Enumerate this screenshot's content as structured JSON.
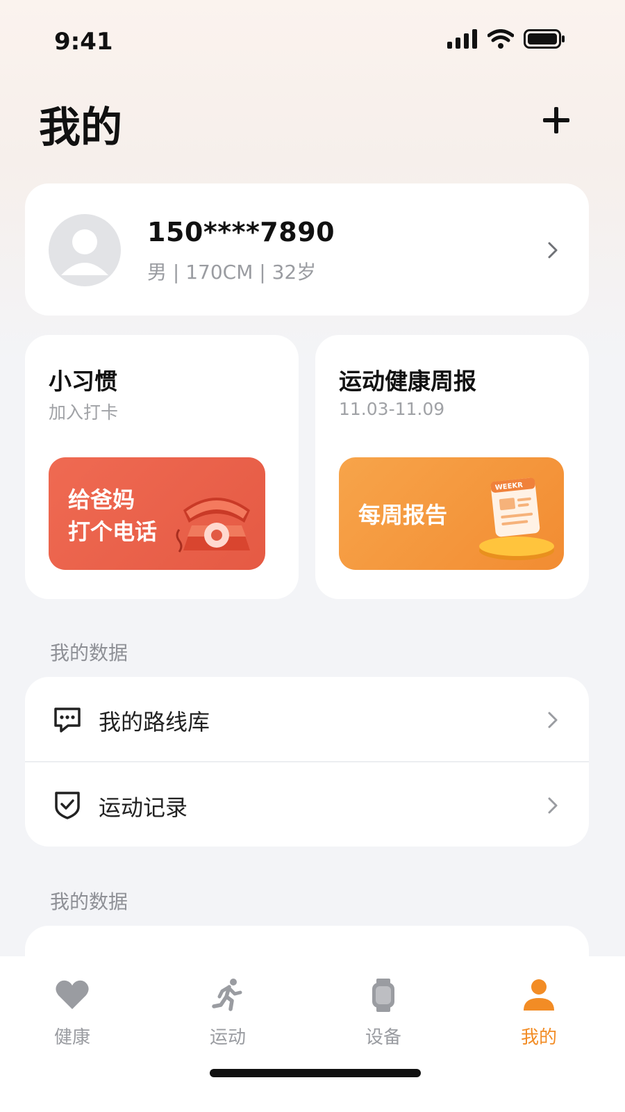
{
  "status_bar": {
    "time": "9:41"
  },
  "header": {
    "title": "我的"
  },
  "profile": {
    "phone": "150****7890",
    "meta": "男 | 170CM | 32岁"
  },
  "habit_card": {
    "title": "小习惯",
    "subtitle": "加入打卡",
    "promo_line1": "给爸妈",
    "promo_line2": "打个电话"
  },
  "weekly_card": {
    "title": "运动健康周报",
    "subtitle": "11.03-11.09",
    "promo": "每周报告",
    "badge": "WEEKR"
  },
  "section1": {
    "label": "我的数据",
    "items": [
      {
        "label": "我的路线库",
        "icon": "message-dots-icon"
      },
      {
        "label": "运动记录",
        "icon": "shield-check-icon"
      }
    ]
  },
  "section2": {
    "label": "我的数据"
  },
  "tabs": [
    {
      "label": "健康",
      "icon": "heart-icon",
      "active": false
    },
    {
      "label": "运动",
      "icon": "running-icon",
      "active": false
    },
    {
      "label": "设备",
      "icon": "watch-icon",
      "active": false
    },
    {
      "label": "我的",
      "icon": "person-icon",
      "active": true
    }
  ],
  "colors": {
    "accent": "#F28C25",
    "promo_red": "#E95F48",
    "promo_orange": "#F39A3D",
    "background": "#F3F4F7"
  }
}
